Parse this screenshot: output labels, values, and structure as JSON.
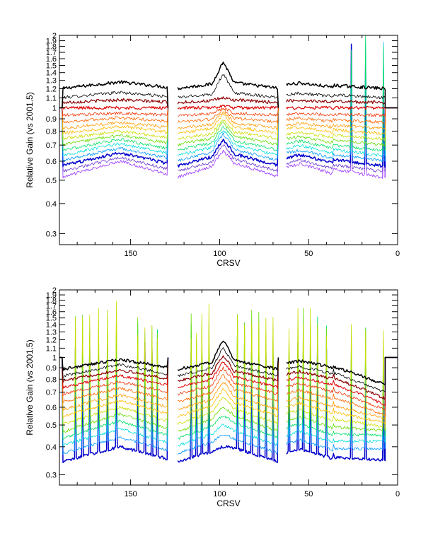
{
  "chart_data": [
    {
      "type": "line",
      "title": "",
      "xlabel": "CRSV",
      "ylabel": "Relative Gain (vs 2001.5)",
      "xlim": [
        190,
        0
      ],
      "ylim": [
        0.27,
        2.0
      ],
      "y_scale": "log",
      "x_ticks": [
        150,
        100,
        50,
        0
      ],
      "y_ticks": [
        0.3,
        0.4,
        0.5,
        0.6,
        0.7,
        0.8,
        0.9,
        1,
        1.1,
        1.2,
        1.3,
        1.4,
        1.5,
        1.6,
        1.7,
        1.8,
        1.9,
        2
      ],
      "y_tick_labels": [
        "0.3",
        "0.4",
        "0.5",
        "0.6",
        "0.7",
        "0.8",
        "0.9",
        "1",
        "1.1",
        "1.2",
        "1.3",
        "1.4",
        "1.5",
        "1.6",
        "1.7",
        "1.8",
        "1.9",
        "2"
      ],
      "grid": false,
      "legend": "none",
      "reference_value": 1.0,
      "gaps": [
        [
          129,
          124
        ],
        [
          67,
          63
        ]
      ],
      "x_range_data": [
        188,
        7
      ],
      "series_colors": [
        "#000000",
        "#000000",
        "#8b0000",
        "#dd0000",
        "#ee3300",
        "#ff6600",
        "#ff9900",
        "#ffbb00",
        "#ccdd00",
        "#66dd00",
        "#00dd66",
        "#00dddd",
        "#0099ff",
        "#0000cc",
        "#6633cc",
        "#9933ff"
      ],
      "series_widths": [
        1.5,
        0.8,
        1.2,
        1.2,
        0.8,
        0.8,
        0.8,
        0.8,
        0.8,
        0.8,
        0.8,
        0.8,
        0.8,
        1.5,
        0.8,
        0.8
      ],
      "series_levels_edge": [
        1.2,
        1.1,
        1.05,
        1.0,
        0.93,
        0.87,
        0.82,
        0.78,
        0.74,
        0.7,
        0.66,
        0.63,
        0.6,
        0.57,
        0.54,
        0.51
      ],
      "series_levels_center": [
        1.28,
        1.16,
        1.08,
        1.0,
        0.95,
        0.91,
        0.87,
        0.84,
        0.8,
        0.77,
        0.74,
        0.71,
        0.68,
        0.65,
        0.62,
        0.6
      ],
      "peak_x": 98,
      "peak_values": [
        1.55,
        1.38,
        1.1,
        1.02,
        1.0,
        0.98,
        0.96,
        0.94,
        0.9,
        0.87,
        0.84,
        0.81,
        0.78,
        0.74,
        0.7,
        0.66
      ],
      "spike_x": [
        26,
        18,
        8,
        63
      ],
      "spike_max": 2.0
    },
    {
      "type": "line",
      "title": "",
      "xlabel": "CRSV",
      "ylabel": "Relative Gain (vs 2001.5)",
      "xlim": [
        190,
        0
      ],
      "ylim": [
        0.27,
        2.0
      ],
      "y_scale": "log",
      "x_ticks": [
        150,
        100,
        50,
        0
      ],
      "y_ticks": [
        0.3,
        0.4,
        0.5,
        0.6,
        0.7,
        0.8,
        0.9,
        1,
        1.1,
        1.2,
        1.3,
        1.4,
        1.5,
        1.6,
        1.7,
        1.8,
        1.9,
        2
      ],
      "y_tick_labels": [
        "0.3",
        "0.4",
        "0.5",
        "0.6",
        "0.7",
        "0.8",
        "0.9",
        "1",
        "1.1",
        "1.2",
        "1.3",
        "1.4",
        "1.5",
        "1.6",
        "1.7",
        "1.8",
        "1.9",
        "2"
      ],
      "grid": false,
      "legend": "none",
      "reference_value": 1.0,
      "gaps": [
        [
          129,
          124
        ],
        [
          67,
          63
        ]
      ],
      "x_range_data": [
        188,
        7
      ],
      "series_colors": [
        "#000000",
        "#000000",
        "#8b0000",
        "#dd0000",
        "#ee3300",
        "#ff6600",
        "#ff9900",
        "#ffbb00",
        "#ccdd00",
        "#66dd00",
        "#00dd66",
        "#00dddd",
        "#0099ff",
        "#0000cc"
      ],
      "series_widths": [
        1.5,
        0.8,
        1.2,
        1.0,
        0.8,
        0.8,
        0.8,
        0.8,
        0.8,
        0.8,
        0.8,
        0.8,
        0.8,
        1.5
      ],
      "series_levels_edge": [
        0.88,
        0.82,
        0.78,
        0.73,
        0.68,
        0.63,
        0.58,
        0.54,
        0.5,
        0.46,
        0.43,
        0.4,
        0.37,
        0.34
      ],
      "series_levels_center": [
        0.98,
        0.93,
        0.88,
        0.83,
        0.78,
        0.73,
        0.68,
        0.64,
        0.6,
        0.56,
        0.52,
        0.48,
        0.44,
        0.4
      ],
      "right_levels": [
        0.72,
        0.66,
        0.62,
        0.58,
        0.55,
        0.52,
        0.5,
        0.48,
        0.46,
        0.44,
        0.42,
        0.4,
        0.37,
        0.33
      ],
      "peak_x": 98,
      "peak_values": [
        1.2,
        1.1,
        1.02,
        0.96,
        0.9,
        0.84,
        0.78,
        0.72,
        0.66,
        0.6,
        0.55,
        0.5,
        0.45,
        0.4
      ],
      "spike_x": [
        181,
        177,
        173,
        168,
        163,
        158,
        146,
        142,
        138,
        135,
        116,
        113,
        110,
        106,
        90,
        86,
        82,
        78,
        74,
        70,
        61,
        56,
        53,
        49,
        45,
        40,
        26,
        18,
        8
      ],
      "spike_max": 2.0
    }
  ]
}
